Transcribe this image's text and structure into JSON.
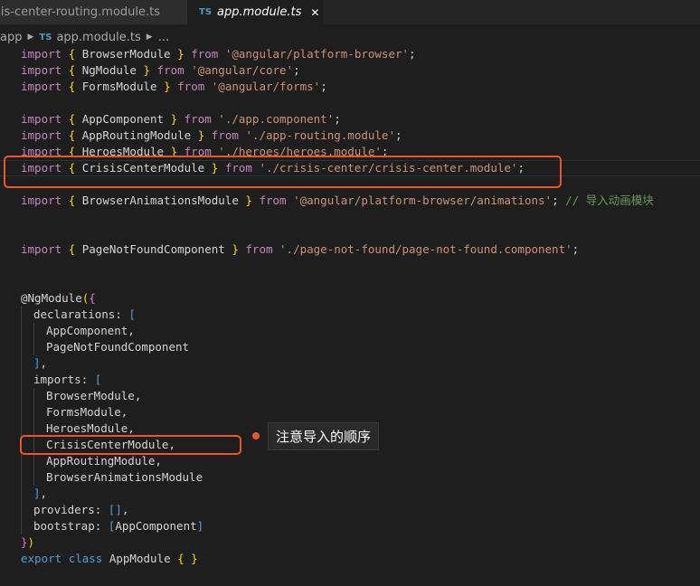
{
  "tabs": [
    {
      "label": "risis-center-routing.module.ts",
      "badge": "",
      "active": false
    },
    {
      "label": "app.module.ts",
      "badge": "TS",
      "active": true,
      "close": "✕"
    }
  ],
  "breadcrumb": {
    "folder": "app",
    "badge": "TS",
    "file": "app.module.ts",
    "more": "..."
  },
  "code": {
    "l1": {
      "kw": "import",
      "ob": "{",
      "name": "BrowserModule",
      "cb": "}",
      "from": "from",
      "path": "'@angular/platform-browser'"
    },
    "l2": {
      "kw": "import",
      "ob": "{",
      "name": "NgModule",
      "cb": "}",
      "from": "from",
      "path": "'@angular/core'"
    },
    "l3": {
      "kw": "import",
      "ob": "{",
      "name": "FormsModule",
      "cb": "}",
      "from": "from",
      "path": "'@angular/forms'"
    },
    "l5": {
      "kw": "import",
      "ob": "{",
      "name": "AppComponent",
      "cb": "}",
      "from": "from",
      "path": "'./app.component'"
    },
    "l6": {
      "kw": "import",
      "ob": "{",
      "name": "AppRoutingModule",
      "cb": "}",
      "from": "from",
      "path": "'./app-routing.module'"
    },
    "l7": {
      "kw": "import",
      "ob": "{",
      "name": "HeroesModule",
      "cb": "}",
      "from": "from",
      "path": "'./heroes/heroes.module'"
    },
    "l8": {
      "kw": "import",
      "ob": "{",
      "name": "CrisisCenterModule",
      "cb": "}",
      "from": "from",
      "path": "'./crisis-center/crisis-center.module'"
    },
    "l10": {
      "kw": "import",
      "ob": "{",
      "name": "BrowserAnimationsModule",
      "cb": "}",
      "from": "from",
      "path": "'@angular/platform-browser/animations'",
      "comment": "// 导入动画模块"
    },
    "l13": {
      "kw": "import",
      "ob": "{",
      "name": "PageNotFoundComponent",
      "cb": "}",
      "from": "from",
      "path": "'./page-not-found/page-not-found.component'"
    },
    "decorator": "@NgModule",
    "declarations": "declarations",
    "decl_items": [
      "AppComponent,",
      "PageNotFoundComponent"
    ],
    "imports": "imports",
    "import_items": [
      "BrowserModule,",
      "FormsModule,",
      "HeroesModule,",
      "CrisisCenterModule,",
      "AppRoutingModule,",
      "BrowserAnimationsModule"
    ],
    "providers": "providers",
    "providers_value": "[]",
    "bootstrap": "bootstrap",
    "bootstrap_value": "AppComponent",
    "export_kw": "export",
    "class_kw": "class",
    "class_name": "AppModule",
    "class_body": "{ }"
  },
  "annotation": {
    "text": "注意导入的顺序"
  },
  "colors": {
    "highlight": "#e8572b",
    "keyword": "#569cd6",
    "string": "#ce9178",
    "comment": "#6a9955",
    "bracket": "#ffd700"
  }
}
